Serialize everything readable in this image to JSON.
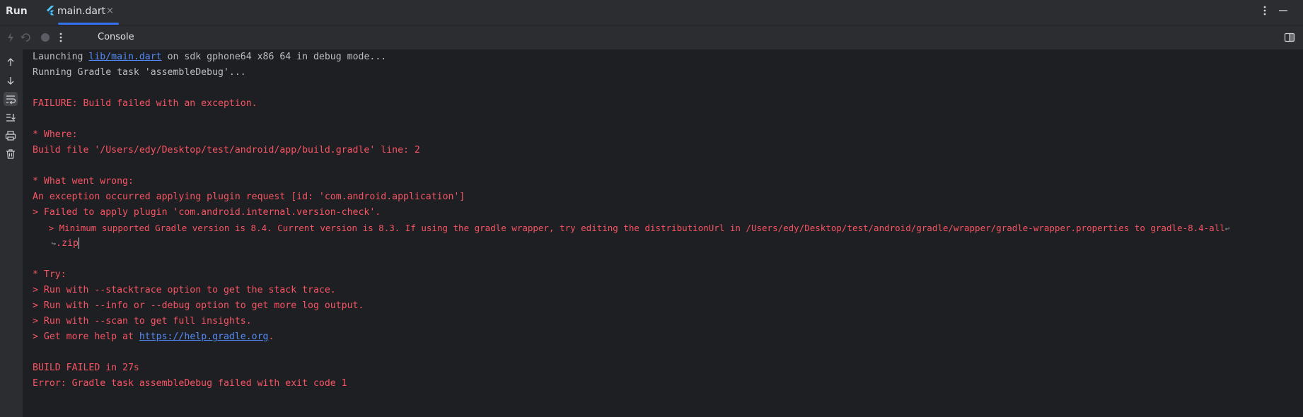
{
  "window": {
    "title": "Run",
    "tab": {
      "label": "main.dart",
      "close_glyph": "×",
      "icon": "flutter-icon"
    }
  },
  "toolbar": {
    "console_label": "Console",
    "icons": [
      "rerun-icon",
      "restart-icon",
      "stop-icon",
      "more-icon",
      "layout-icon"
    ]
  },
  "gutter": {
    "icons": [
      "arrow-up-icon",
      "arrow-down-icon",
      "soft-wrap-icon",
      "scroll-to-end-icon",
      "print-icon",
      "trash-icon"
    ]
  },
  "colors": {
    "accent": "#3574f0",
    "error_text": "#f75464",
    "normal_text": "#bcbec4",
    "link": "#548af7",
    "background": "#1e1f22",
    "panel": "#2b2d30"
  },
  "console": {
    "line1": {
      "prefix": "Launching ",
      "link": "lib/main.dart",
      "suffix": " on sdk gphone64 x86 64 in debug mode..."
    },
    "line2": "Running Gradle task 'assembleDebug'...",
    "line3": "FAILURE: Build failed with an exception.",
    "line4": "* Where:",
    "line5": "Build file '/Users/edy/Desktop/test/android/app/build.gradle' line: 2",
    "line6": "* What went wrong:",
    "line7": "An exception occurred applying plugin request [id: 'com.android.application']",
    "line8": "> Failed to apply plugin 'com.android.internal.version-check'.",
    "line9": "   > Minimum supported Gradle version is 8.4. Current version is 8.3. If using the gradle wrapper, try editing the distributionUrl in /Users/edy/Desktop/test/android/gradle/wrapper/gradle-wrapper.properties to gradle-8.4-all",
    "line10": ".zip",
    "line11": "* Try:",
    "line12": "> Run with --stacktrace option to get the stack trace.",
    "line13": "> Run with --info or --debug option to get more log output.",
    "line14": "> Run with --scan to get full insights.",
    "line15": {
      "prefix": "> Get more help at ",
      "link": "https://help.gradle.org",
      "suffix": "."
    },
    "line16": "BUILD FAILED in 27s",
    "line17": "Error: Gradle task assembleDebug failed with exit code 1"
  }
}
